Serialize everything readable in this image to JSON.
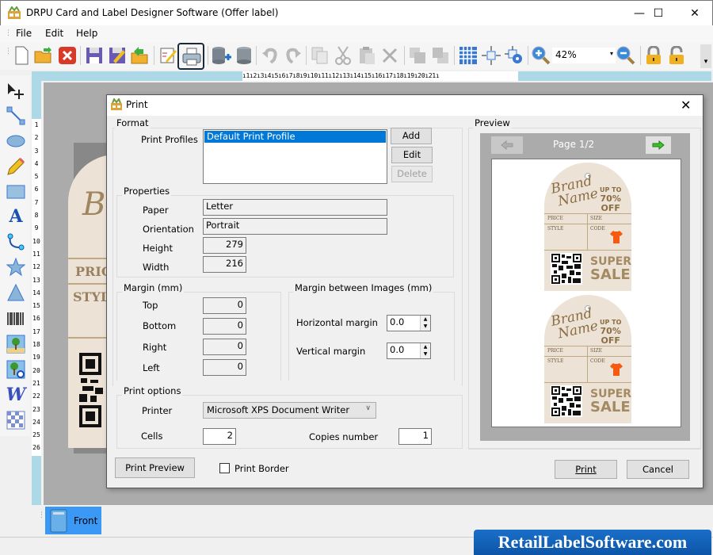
{
  "window": {
    "title": "DRPU Card and Label Designer Software (Offer label)",
    "minimize": "—",
    "maximize": "☐",
    "close": "✕"
  },
  "menu": {
    "items": [
      {
        "label": "File"
      },
      {
        "label": "Edit"
      },
      {
        "label": "Help"
      }
    ]
  },
  "toolbar": {
    "buttons": [
      "new-icon",
      "open-icon",
      "close-file-icon",
      "save-icon",
      "save-as-icon",
      "export-icon",
      "edit-icon",
      "print-icon",
      "database-add-icon",
      "database-icon",
      "undo-icon",
      "redo-icon",
      "copy-icon",
      "cut-icon",
      "paste-icon",
      "delete-icon",
      "bring-front-icon",
      "send-back-icon",
      "grid-icon",
      "fit-icon",
      "fit-settings-icon",
      "zoom-in-icon",
      "zoom-out-icon",
      "lock-icon",
      "unlock-icon"
    ],
    "zoom_value": "42%",
    "active_button": "print-icon"
  },
  "left_tools": [
    "select-move-icon",
    "line-icon",
    "ellipse-icon",
    "pencil-icon",
    "rectangle-icon",
    "text-icon",
    "curve-icon",
    "star-icon",
    "triangle-icon",
    "barcode-icon",
    "image-icon",
    "image-library-icon",
    "wordart-icon",
    "watermark-icon"
  ],
  "ruler": {
    "h_marks": "ı1ı2ı3ı4ı5ı6ı7ı8ı9ı10ı11ı12ı13ı14ı15ı16ı17ı18ı19ı20ı21ı",
    "v_marks": [
      "1",
      "2",
      "3",
      "4",
      "5",
      "6",
      "7",
      "8",
      "9",
      "10",
      "11",
      "12",
      "13",
      "14",
      "15",
      "16",
      "17",
      "18",
      "19",
      "20",
      "21",
      "22",
      "23",
      "24",
      "25",
      "26"
    ]
  },
  "canvas_label": {
    "price": "PRIC",
    "style": "STYL"
  },
  "page_tabs": [
    {
      "label": "Front",
      "active": true
    }
  ],
  "watermark": "RetailLabelSoftware.com",
  "dialog": {
    "title": "Print",
    "close": "✕",
    "format": {
      "group_label": "Format",
      "profiles_label": "Print Profiles",
      "profiles": [
        "Default Print Profile"
      ],
      "selected_profile": "Default Print Profile",
      "add": "Add",
      "edit": "Edit",
      "delete": "Delete"
    },
    "properties": {
      "group_label": "Properties",
      "paper_label": "Paper",
      "paper": "Letter",
      "orientation_label": "Orientation",
      "orientation": "Portrait",
      "height_label": "Height",
      "height": "279",
      "width_label": "Width",
      "width": "216"
    },
    "margin": {
      "group_label": "Margin (mm)",
      "top_label": "Top",
      "top": "0",
      "bottom_label": "Bottom",
      "bottom": "0",
      "right_label": "Right",
      "right": "0",
      "left_label": "Left",
      "left": "0"
    },
    "margin_between": {
      "group_label": "Margin between Images (mm)",
      "horizontal_label": "Horizontal margin",
      "horizontal": "0.0",
      "vertical_label": "Vertical margin",
      "vertical": "0.0"
    },
    "print_options": {
      "group_label": "Print options",
      "printer_label": "Printer",
      "printer": "Microsoft XPS Document Writer",
      "cells_label": "Cells",
      "cells": "2",
      "copies_label": "Copies number",
      "copies": "1"
    },
    "print_preview_button": "Print Preview",
    "print_border_label": "Print Border",
    "print_border_checked": false,
    "print_button": "Print",
    "cancel_button": "Cancel",
    "preview": {
      "group_label": "Preview",
      "page_text": "Page 1/2",
      "tags": [
        {
          "brand1": "Brand",
          "brand2": "Name",
          "upto": "UP TO",
          "pct": "70%",
          "off": "OFF",
          "price": "PRICE",
          "size": "SIZE",
          "style": "STYLE",
          "code": "CODE",
          "super": "SUPER",
          "sale": "SALE"
        },
        {
          "brand1": "Brand",
          "brand2": "Name",
          "upto": "UP TO",
          "pct": "70%",
          "off": "OFF",
          "price": "PRICE",
          "size": "SIZE",
          "style": "STYLE",
          "code": "CODE",
          "super": "SUPER",
          "sale": "SALE"
        }
      ]
    }
  }
}
